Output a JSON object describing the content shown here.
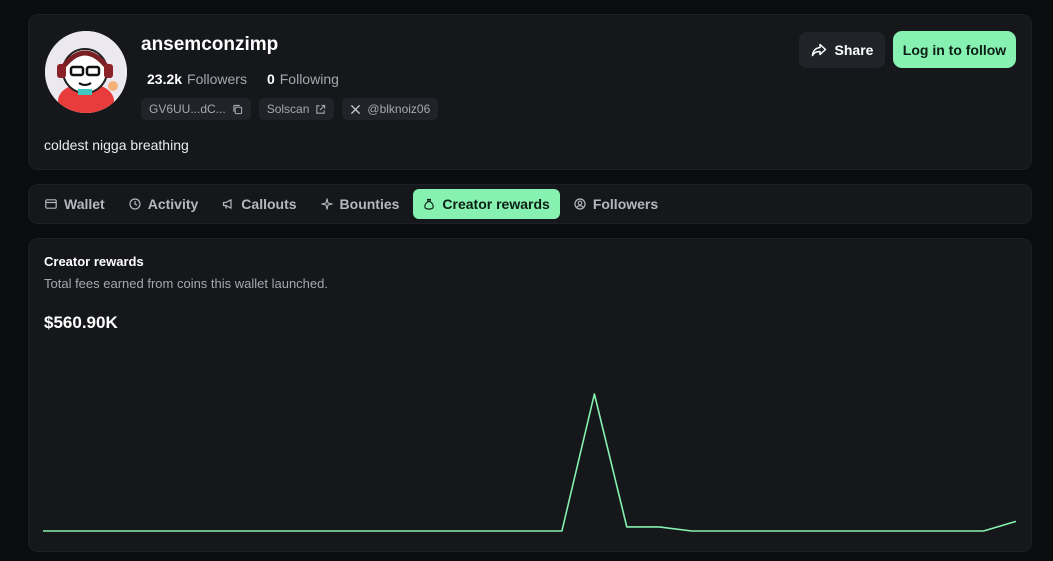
{
  "profile": {
    "username": "ansemconzimp",
    "followers_count": "23.2k",
    "followers_label": "Followers",
    "following_count": "0",
    "following_label": "Following",
    "address": "GV6UU...dC...",
    "solscan_label": "Solscan",
    "twitter_handle": "@blknoiz06",
    "bio": "coldest nigga breathing"
  },
  "actions": {
    "share_label": "Share",
    "follow_label": "Log in to follow"
  },
  "tabs": [
    {
      "label": "Wallet",
      "icon": "wallet-icon"
    },
    {
      "label": "Activity",
      "icon": "clock-icon"
    },
    {
      "label": "Callouts",
      "icon": "megaphone-icon"
    },
    {
      "label": "Bounties",
      "icon": "sparkle-icon"
    },
    {
      "label": "Creator rewards",
      "icon": "money-bag-icon",
      "active": true
    },
    {
      "label": "Followers",
      "icon": "user-circle-icon"
    }
  ],
  "rewards": {
    "title": "Creator rewards",
    "subtitle": "Total fees earned from coins this wallet launched.",
    "total": "$560.90K"
  },
  "chart_data": {
    "type": "line",
    "color": "#86f1b0",
    "x": [
      0,
      1,
      2,
      3,
      4,
      5,
      6,
      7,
      8,
      9,
      10,
      11,
      12,
      13,
      14,
      15,
      16,
      17,
      18,
      19,
      20,
      21,
      22,
      23,
      24,
      25,
      26,
      27,
      28,
      29,
      30
    ],
    "values": [
      0,
      0,
      0,
      0,
      0,
      0,
      0,
      0,
      0,
      0,
      0,
      0,
      0,
      0,
      0,
      0,
      0,
      1.0,
      0.03,
      0.03,
      0,
      0,
      0,
      0,
      0,
      0,
      0,
      0,
      0,
      0,
      0.07
    ],
    "grid": false,
    "xlabel": "",
    "ylabel": ""
  }
}
